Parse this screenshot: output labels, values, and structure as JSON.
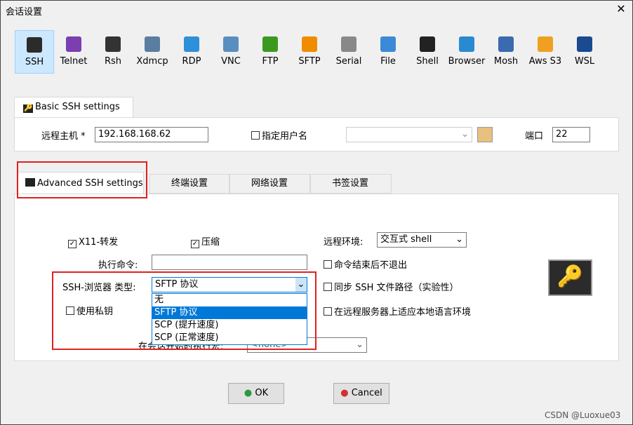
{
  "window": {
    "title": "会话设置",
    "close": "✕"
  },
  "protocols": [
    {
      "label": "SSH",
      "color": "#2b2b2b"
    },
    {
      "label": "Telnet",
      "color": "#7b3fb0"
    },
    {
      "label": "Rsh",
      "color": "#333333"
    },
    {
      "label": "Xdmcp",
      "color": "#5a7ea0"
    },
    {
      "label": "RDP",
      "color": "#2f8fd8"
    },
    {
      "label": "VNC",
      "color": "#5a8ec0"
    },
    {
      "label": "FTP",
      "color": "#3a9a20"
    },
    {
      "label": "SFTP",
      "color": "#f08c00"
    },
    {
      "label": "Serial",
      "color": "#888888"
    },
    {
      "label": "File",
      "color": "#3a8ad8"
    },
    {
      "label": "Shell",
      "color": "#222222"
    },
    {
      "label": "Browser",
      "color": "#2a8ad0"
    },
    {
      "label": "Mosh",
      "color": "#3a6ab0"
    },
    {
      "label": "Aws S3",
      "color": "#f0a020"
    },
    {
      "label": "WSL",
      "color": "#1a4a90"
    }
  ],
  "basic": {
    "tab": "Basic SSH settings",
    "host_label": "远程主机 *",
    "host": "192.168.168.62",
    "user_label": "指定用户名",
    "user": "",
    "port_label": "端口",
    "port": "22"
  },
  "tabs": [
    "Advanced SSH settings",
    "终端设置",
    "网络设置",
    "书签设置"
  ],
  "advanced": {
    "x11": "X11-转发",
    "x11_checked": true,
    "compress": "压缩",
    "compress_checked": true,
    "remote_env_label": "远程环境:",
    "remote_env": "交互式 shell",
    "exec_label": "执行命令:",
    "exec": "",
    "no_exit": "命令结束后不退出",
    "browser_label": "SSH-浏览器 类型:",
    "browser": "SFTP 协议",
    "browser_options": [
      "无",
      "SFTP 协议",
      "SCP (提升速度)",
      "SCP (正常速度)"
    ],
    "browser_selected": 1,
    "sync": "同步 SSH 文件路径（实验性）",
    "private_key": "使用私钥",
    "locale": "在远程服务器上适应本地语言环境",
    "macro_label": "在会话开始时执行宏:",
    "macro": "<none>"
  },
  "buttons": {
    "ok": "OK",
    "cancel": "Cancel"
  },
  "watermark": "CSDN @Luoxue03"
}
